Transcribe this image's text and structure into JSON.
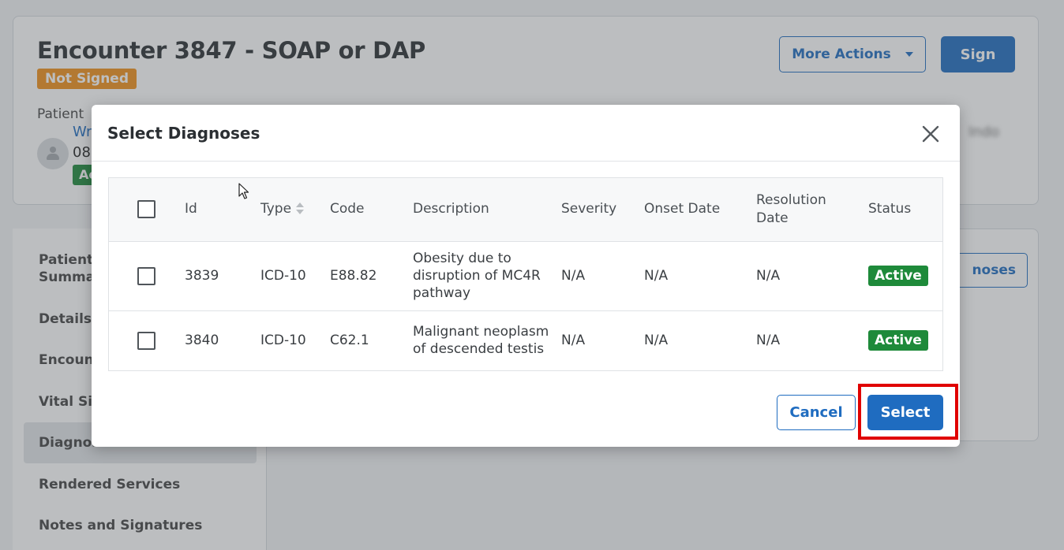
{
  "encounter": {
    "title": "Encounter 3847 - SOAP or DAP",
    "status": "Not Signed",
    "more_actions_label": "More Actions",
    "sign_label": "Sign",
    "patient_label": "Patient",
    "patient_name_fragment": "Wr",
    "patient_dob_fragment": "08",
    "patient_badge_fragment": "Ac",
    "blurred_text": "Indo"
  },
  "side_nav": {
    "items": [
      "Patient's Summary",
      "Details",
      "Encounter",
      "Vital Signs",
      "Diagnoses",
      "Rendered Services",
      "Notes and Signatures"
    ],
    "visible_fragments": [
      "Patient's",
      "Summar",
      "Details",
      "Encount",
      "Vital Sig",
      "Diagnoses",
      "Rendered Services",
      "Notes and Signatures"
    ],
    "active_item": "Diagnoses"
  },
  "add_diagnoses_fragment": "noses",
  "modal": {
    "title": "Select Diagnoses",
    "columns": [
      "Id",
      "Type",
      "Code",
      "Description",
      "Severity",
      "Onset Date",
      "Resolution Date",
      "Status"
    ],
    "rows": [
      {
        "id": "3839",
        "type": "ICD-10",
        "code": "E88.82",
        "description": "Obesity due to disruption of MC4R pathway",
        "severity": "N/A",
        "onset_date": "N/A",
        "resolution_date": "N/A",
        "status": "Active"
      },
      {
        "id": "3840",
        "type": "ICD-10",
        "code": "C62.1",
        "description": "Malignant neoplasm of descended testis",
        "severity": "N/A",
        "onset_date": "N/A",
        "resolution_date": "N/A",
        "status": "Active"
      }
    ],
    "cancel_label": "Cancel",
    "select_label": "Select"
  },
  "colors": {
    "primary": "#1f6cc0",
    "status_not_signed": "#f0901a",
    "status_active": "#1e8a3a",
    "highlight": "#e00000"
  }
}
